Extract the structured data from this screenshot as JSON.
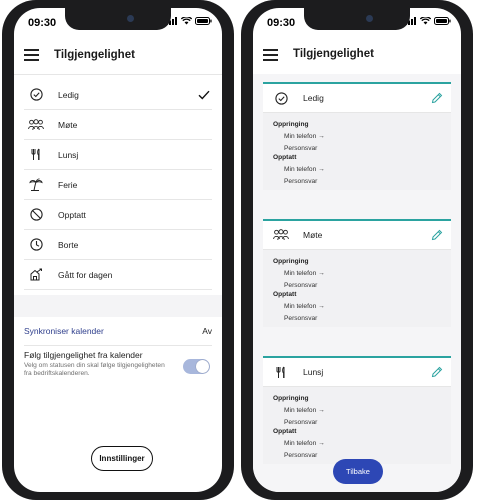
{
  "status_bar": {
    "time": "09:30"
  },
  "left_screen": {
    "header": {
      "title": "Tilgjengelighet"
    },
    "statuses": [
      {
        "label": "Ledig",
        "icon": "check-circle-icon",
        "selected": true
      },
      {
        "label": "Møte",
        "icon": "people-icon",
        "selected": false
      },
      {
        "label": "Lunsj",
        "icon": "cutlery-icon",
        "selected": false
      },
      {
        "label": "Ferie",
        "icon": "palm-tree-icon",
        "selected": false
      },
      {
        "label": "Opptatt",
        "icon": "no-entry-icon",
        "selected": false
      },
      {
        "label": "Borte",
        "icon": "clock-icon",
        "selected": false
      },
      {
        "label": "Gått for dagen",
        "icon": "leave-icon",
        "selected": false
      }
    ],
    "sync": {
      "label": "Synkroniser kalender",
      "value": "Av"
    },
    "follow_calendar": {
      "title": "Følg tilgjengelighet fra kalender",
      "description": "Velg om statusen din skal følge tilgjengeligheten fra bedriftskalenderen.",
      "enabled": true
    },
    "settings_button": "Innstillinger"
  },
  "right_screen": {
    "header": {
      "title": "Tilgjengelighet"
    },
    "cards": [
      {
        "label": "Ledig",
        "icon": "check-circle-icon",
        "sections": [
          {
            "title": "Oppringing",
            "items": [
              "Min telefon →",
              "Personsvar"
            ]
          },
          {
            "title": "Opptatt",
            "items": [
              "Min telefon →",
              "Personsvar"
            ]
          }
        ]
      },
      {
        "label": "Møte",
        "icon": "people-icon",
        "sections": [
          {
            "title": "Oppringing",
            "items": [
              "Min telefon →",
              "Personsvar"
            ]
          },
          {
            "title": "Opptatt",
            "items": [
              "Min telefon →",
              "Personsvar"
            ]
          }
        ]
      },
      {
        "label": "Lunsj",
        "icon": "cutlery-icon",
        "sections": [
          {
            "title": "Oppringing",
            "items": [
              "Min telefon →",
              "Personsvar"
            ]
          },
          {
            "title": "Opptatt",
            "items": [
              "Min telefon →",
              "Personsvar"
            ]
          }
        ]
      }
    ],
    "back_button": "Tilbake"
  },
  "colors": {
    "accent_teal": "#2ba3a0",
    "primary_blue": "#2d47b5",
    "link_blue": "#2e3e8c",
    "toggle_on": "#a8b7dc"
  }
}
